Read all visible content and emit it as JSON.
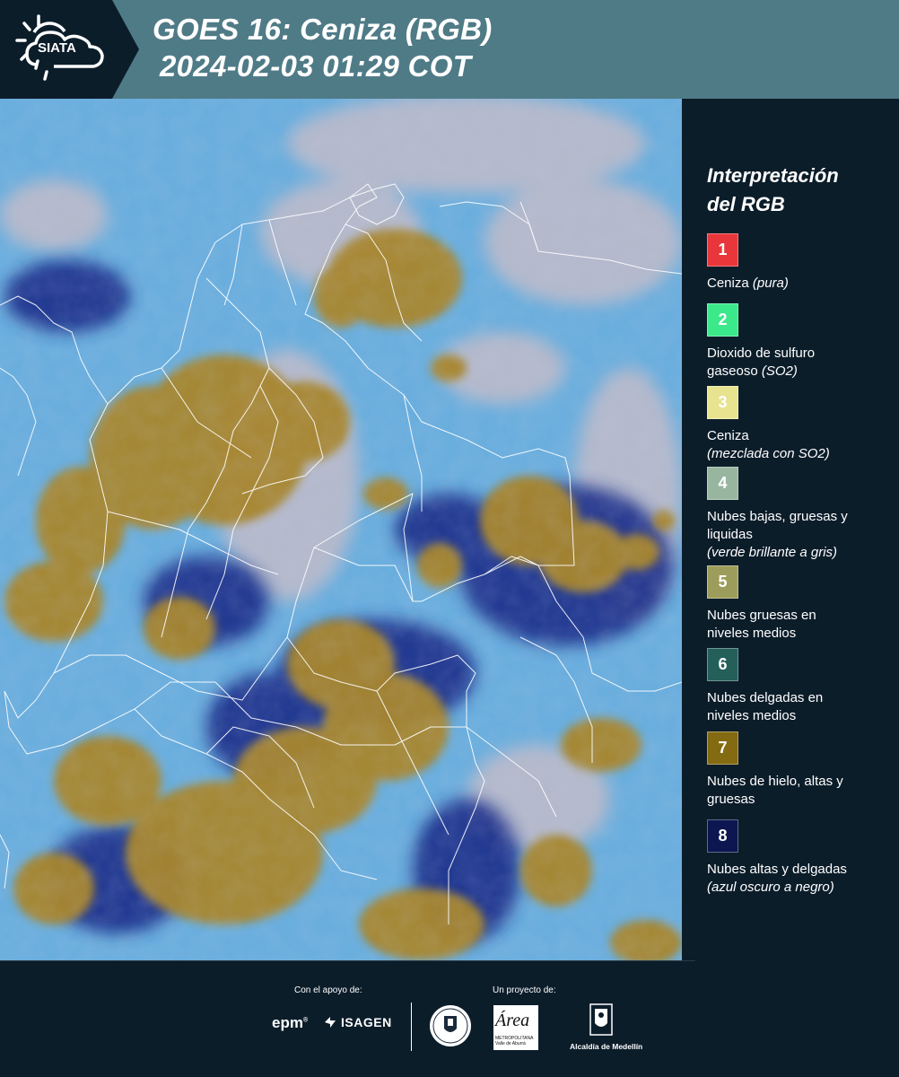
{
  "header": {
    "logo_text": "SIATA",
    "title_line1": "GOES 16: Ceniza (RGB)",
    "title_line2": "2024-02-03 01:29 COT"
  },
  "legend": {
    "title_line1": "Interpretación",
    "title_line2": "del RGB",
    "items": [
      {
        "number": "1",
        "color": "#e8363a",
        "label": "Ceniza",
        "note": "(pura)"
      },
      {
        "number": "2",
        "color": "#3be88a",
        "label": "Dioxido de sulfuro gaseoso",
        "note": "(SO2)"
      },
      {
        "number": "3",
        "color": "#e7e38f",
        "label": "Ceniza",
        "note": "(mezclada con SO2)"
      },
      {
        "number": "4",
        "color": "#98b59f",
        "label": "Nubes bajas, gruesas y liquidas",
        "note": "(verde brillante a gris)"
      },
      {
        "number": "5",
        "color": "#9d9d5b",
        "label": "Nubes gruesas en niveles medios",
        "note": ""
      },
      {
        "number": "6",
        "color": "#245f5a",
        "label": "Nubes delgadas en niveles medios",
        "note": ""
      },
      {
        "number": "7",
        "color": "#846a10",
        "label": "Nubes de hielo, altas y gruesas",
        "note": ""
      },
      {
        "number": "8",
        "color": "#0d1650",
        "label": "Nubes altas y delgadas",
        "note": "(azul oscuro a negro)"
      }
    ]
  },
  "footer": {
    "support_label": "Con el apoyo de:",
    "project_label": "Un proyecto de:",
    "sponsor1": "epm",
    "sponsor2": "ISAGEN",
    "partner_amva": "Área",
    "partner_amva_sub": "METROPOLITANA",
    "partner_amva_sub2": "Valle de Aburrá",
    "partner_alcaldia": "Alcaldía de Medellín"
  },
  "map_colors": {
    "background_blue": "#6aaede",
    "ice_cloud": "#a8862e",
    "thin_high_cloud": "#1a2f86",
    "pinkish_haze": "#c9b8c4",
    "border_lines": "#ffffff"
  }
}
